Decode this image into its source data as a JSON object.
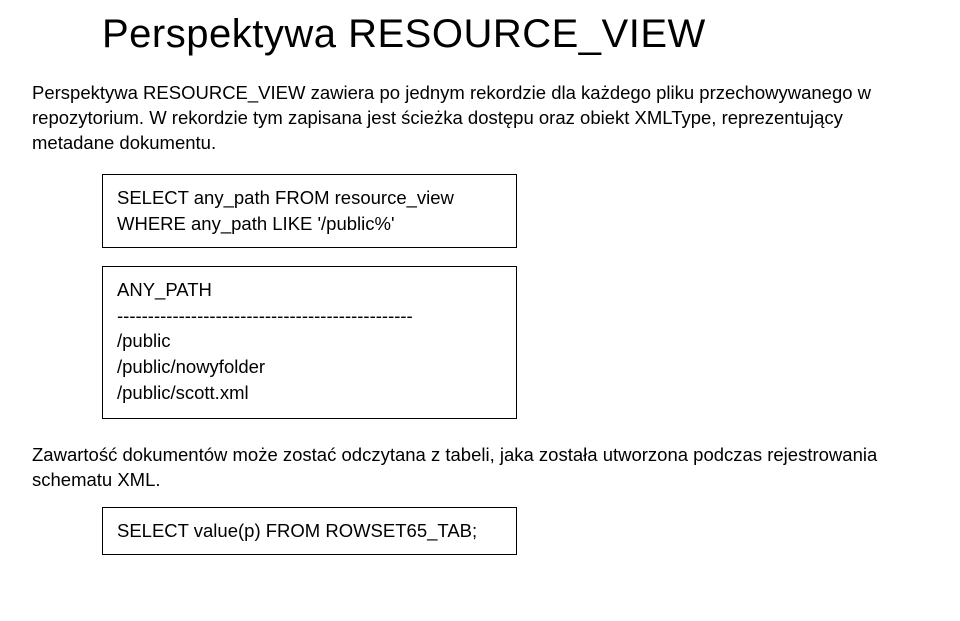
{
  "title": "Perspektywa RESOURCE_VIEW",
  "paragraph1": "Perspektywa RESOURCE_VIEW zawiera po jednym rekordzie dla każdego pliku przechowywanego w repozytorium. W rekordzie tym zapisana jest ścieżka dostępu oraz obiekt XMLType, reprezentujący metadane dokumentu.",
  "codeBox1": {
    "line1": "SELECT any_path FROM resource_view",
    "line2": "WHERE any_path LIKE '/public%'"
  },
  "codeBox2": {
    "line1": "ANY_PATH",
    "line2": "------------------------------------------------",
    "line3": "/public",
    "line4": "/public/nowyfolder",
    "line5": "/public/scott.xml"
  },
  "paragraph2": "Zawartość dokumentów może zostać odczytana z tabeli, jaka została utworzona podczas rejestrowania schematu XML.",
  "codeBox3": {
    "line1": "SELECT value(p) FROM ROWSET65_TAB;"
  }
}
